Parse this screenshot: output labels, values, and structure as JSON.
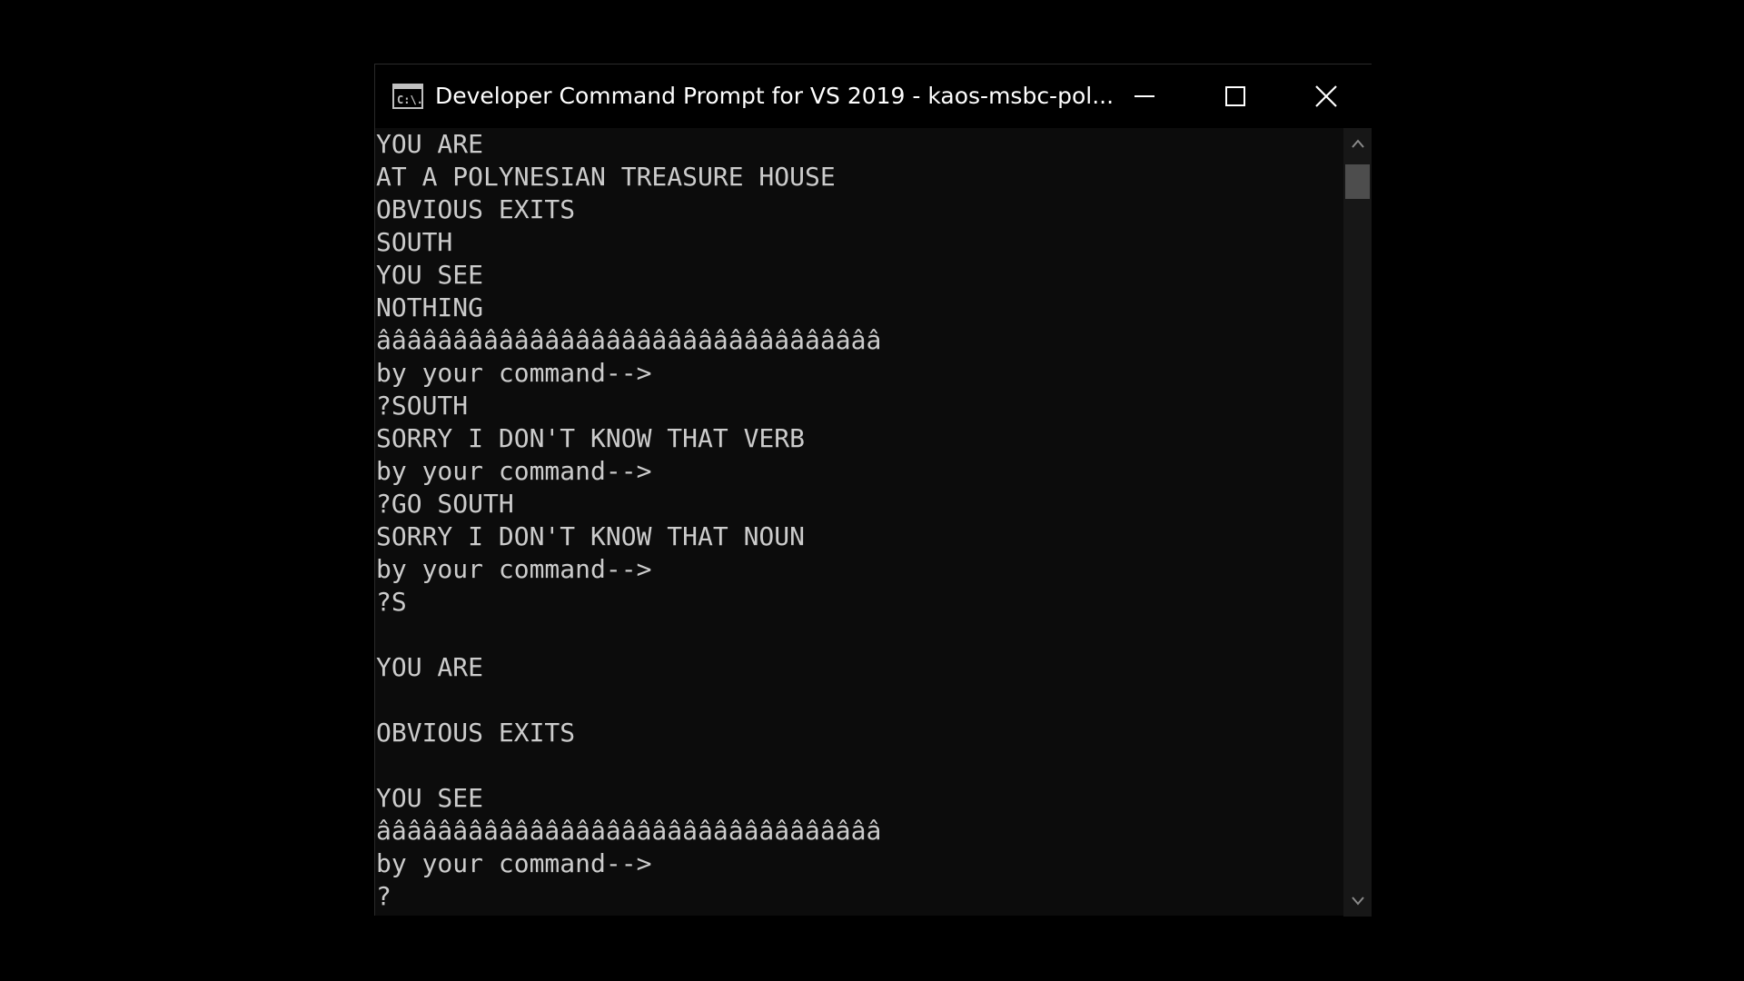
{
  "window": {
    "title": "Developer Command Prompt for VS 2019 - kaos-msbc-pol...",
    "app_icon": "cmd-icon",
    "app_icon_text": "C:\\."
  },
  "controls": {
    "minimize": "minimize-icon",
    "maximize": "maximize-icon",
    "close": "close-icon"
  },
  "console": {
    "lines": [
      "YOU ARE",
      "AT A POLYNESIAN TREASURE HOUSE",
      "OBVIOUS EXITS",
      "SOUTH",
      "YOU SEE",
      "NOTHING",
      "âââââââââââââââââââââââââââââââââ",
      "by your command-->",
      "?SOUTH",
      "SORRY I DON'T KNOW THAT VERB",
      "by your command-->",
      "?GO SOUTH",
      "SORRY I DON'T KNOW THAT NOUN",
      "by your command-->",
      "?S",
      "",
      "YOU ARE",
      "",
      "OBVIOUS EXITS",
      "",
      "YOU SEE",
      "âââââââââââââââââââââââââââââââââ",
      "by your command-->",
      "?"
    ]
  },
  "colors": {
    "console_text": "#cccccc",
    "console_bg": "#0c0c0c",
    "titlebar_bg": "#000000",
    "scroll_track": "#171717",
    "scroll_thumb": "#4d4d4d"
  }
}
